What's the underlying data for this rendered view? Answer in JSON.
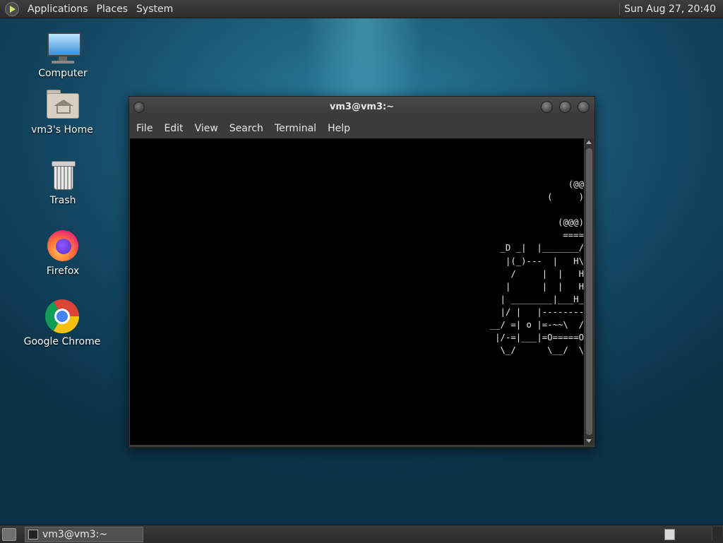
{
  "top_panel": {
    "menus": [
      "Applications",
      "Places",
      "System"
    ],
    "clock": "Sun Aug 27, 20:40",
    "logo_icon": "mate-logo-icon"
  },
  "desktop_icons": [
    {
      "label": "Computer",
      "icon": "computer-icon"
    },
    {
      "label": "vm3's Home",
      "icon": "home-folder-icon"
    },
    {
      "label": "Trash",
      "icon": "trash-icon"
    },
    {
      "label": "Firefox",
      "icon": "firefox-icon"
    },
    {
      "label": "Google Chrome",
      "icon": "chrome-icon"
    }
  ],
  "terminal": {
    "title": "vm3@vm3:~",
    "menu": [
      "File",
      "Edit",
      "View",
      "Search",
      "Terminal",
      "Help"
    ],
    "output": "(@@\n(     )\n\n(@@@)\n====\n_D _|  |_______/\n|(_)---  |   H\\\n/     |  |   H\n|      |  |   H\n| ________|___H_\n|/ |   |--------\n__/ =| o |=-~~\\  /\n|/-=|___|=O=====O\n\\_/      \\__/  \\"
  },
  "bottom_panel": {
    "task_label": "vm3@vm3:~"
  },
  "colors": {
    "panel_bg": "#2d2d2d",
    "terminal_bg": "#000000",
    "terminal_fg": "#e8e8e8",
    "desktop_bg": "#1d5f7c"
  }
}
